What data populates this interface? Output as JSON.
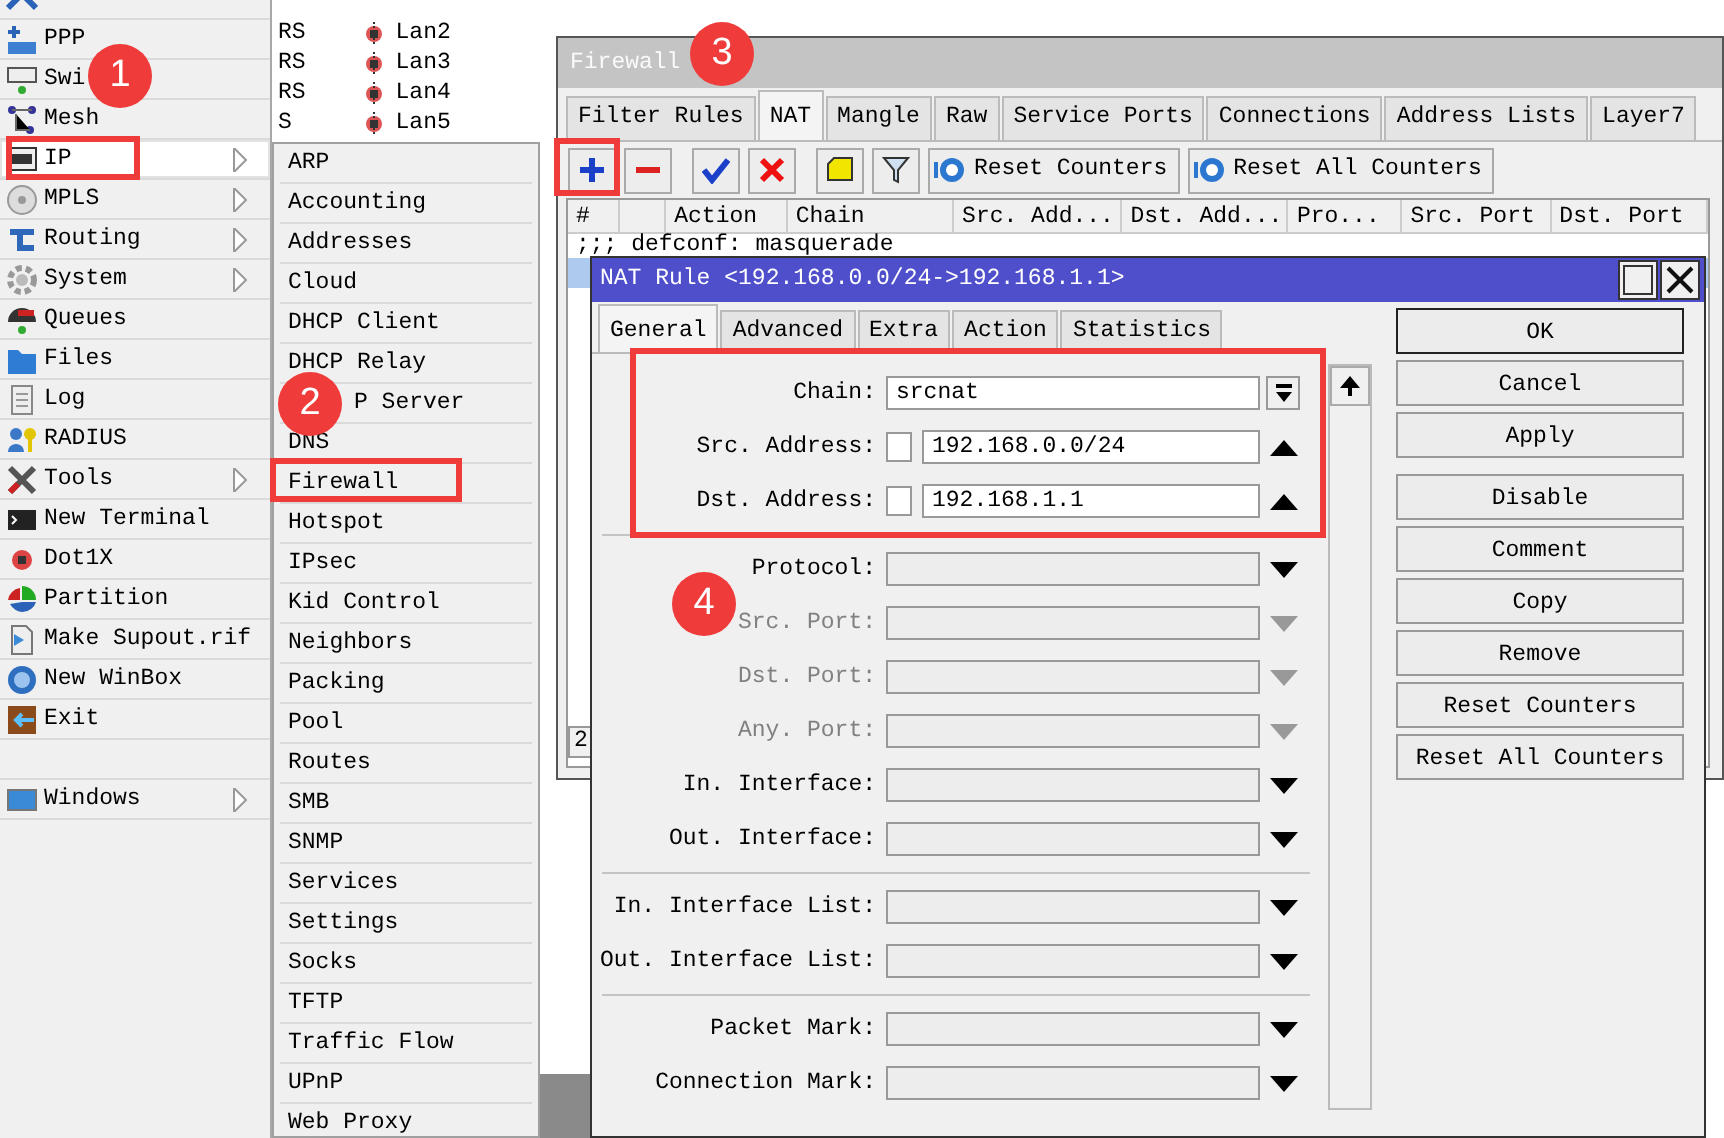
{
  "interfaces": {
    "rows": [
      {
        "flags": "RS",
        "name": "Lan2"
      },
      {
        "flags": "RS",
        "name": "Lan3"
      },
      {
        "flags": "RS",
        "name": "Lan4"
      },
      {
        "flags": "S",
        "name": "Lan5"
      }
    ]
  },
  "left_menu": {
    "items": [
      {
        "kind": "cut",
        "submenu": false,
        "selected": false
      },
      {
        "kind": "item",
        "label": "PPP",
        "submenu": false,
        "selected": false
      },
      {
        "kind": "item",
        "label": "Swi",
        "submenu": false,
        "selected": false
      },
      {
        "kind": "item",
        "label": "Mesh",
        "submenu": false,
        "selected": false
      },
      {
        "kind": "item",
        "label": "IP",
        "submenu": true,
        "selected": true
      },
      {
        "kind": "item",
        "label": "MPLS",
        "submenu": true,
        "selected": false
      },
      {
        "kind": "item",
        "label": "Routing",
        "submenu": true,
        "selected": false
      },
      {
        "kind": "item",
        "label": "System",
        "submenu": true,
        "selected": false
      },
      {
        "kind": "item",
        "label": "Queues",
        "submenu": false,
        "selected": false
      },
      {
        "kind": "item",
        "label": "Files",
        "submenu": false,
        "selected": false
      },
      {
        "kind": "item",
        "label": "Log",
        "submenu": false,
        "selected": false
      },
      {
        "kind": "item",
        "label": "RADIUS",
        "submenu": false,
        "selected": false
      },
      {
        "kind": "item",
        "label": "Tools",
        "submenu": true,
        "selected": false
      },
      {
        "kind": "item",
        "label": "New Terminal",
        "submenu": false,
        "selected": false
      },
      {
        "kind": "item",
        "label": "Dot1X",
        "submenu": false,
        "selected": false
      },
      {
        "kind": "item",
        "label": "Partition",
        "submenu": false,
        "selected": false
      },
      {
        "kind": "item",
        "label": "Make Supout.rif",
        "submenu": false,
        "selected": false
      },
      {
        "kind": "item",
        "label": "New WinBox",
        "submenu": false,
        "selected": false
      },
      {
        "kind": "item",
        "label": "Exit",
        "submenu": false,
        "selected": false
      },
      {
        "kind": "spacer"
      },
      {
        "kind": "item",
        "label": "Windows",
        "submenu": true,
        "selected": false
      }
    ]
  },
  "ip_submenu": {
    "items": [
      "ARP",
      "Accounting",
      "Addresses",
      "Cloud",
      "DHCP Client",
      "DHCP Relay",
      "P Server",
      "DNS",
      "Firewall",
      "Hotspot",
      "IPsec",
      "Kid Control",
      "Neighbors",
      "Packing",
      "Pool",
      "Routes",
      "SMB",
      "SNMP",
      "Services",
      "Settings",
      "Socks",
      "TFTP",
      "Traffic Flow",
      "UPnP",
      "Web Proxy"
    ]
  },
  "firewall": {
    "title": "Firewall",
    "tabs": [
      {
        "label": "Filter Rules",
        "selected": false
      },
      {
        "label": "NAT",
        "selected": true
      },
      {
        "label": "Mangle",
        "selected": false
      },
      {
        "label": "Raw",
        "selected": false
      },
      {
        "label": "Service Ports",
        "selected": false
      },
      {
        "label": "Connections",
        "selected": false
      },
      {
        "label": "Address Lists",
        "selected": false
      },
      {
        "label": "Layer7",
        "selected": false
      }
    ],
    "toolbar_buttons": [
      "Reset Counters",
      "Reset All Counters"
    ],
    "columns": [
      "#",
      "Action",
      "Chain",
      "Src. Add...",
      "Dst. Add...",
      "Pro...",
      "Src. Port",
      "Dst. Port"
    ],
    "rows": [
      {
        "kind": "comment",
        "text": ";;; defconf: masquerade",
        "selected": false
      },
      {
        "kind": "rule",
        "selected": true
      }
    ],
    "status": "2"
  },
  "nat_rule": {
    "title": "NAT Rule <192.168.0.0/24->192.168.1.1>",
    "tabs": [
      {
        "label": "General",
        "selected": true
      },
      {
        "label": "Advanced",
        "selected": false
      },
      {
        "label": "Extra",
        "selected": false
      },
      {
        "label": "Action",
        "selected": false
      },
      {
        "label": "Statistics",
        "selected": false
      }
    ],
    "groups": [
      {
        "fields": [
          {
            "kind": "chain",
            "label": "Chain:",
            "value": "srcnat",
            "disabled": false
          },
          {
            "kind": "address",
            "label": "Src. Address:",
            "value": "192.168.0.0/24",
            "negated": false,
            "disabled": false
          },
          {
            "kind": "address",
            "label": "Dst. Address:",
            "value": "192.168.1.1",
            "negated": false,
            "disabled": false
          }
        ]
      },
      {
        "fields": [
          {
            "kind": "select",
            "label": "Protocol:",
            "disabled": false
          },
          {
            "kind": "select",
            "label": "Src. Port:",
            "disabled": true
          },
          {
            "kind": "select",
            "label": "Dst. Port:",
            "disabled": true
          },
          {
            "kind": "select",
            "label": "Any. Port:",
            "disabled": true
          },
          {
            "kind": "select",
            "label": "In. Interface:",
            "disabled": false
          },
          {
            "kind": "select",
            "label": "Out. Interface:",
            "disabled": false
          }
        ]
      },
      {
        "fields": [
          {
            "kind": "select",
            "label": "In. Interface List:",
            "disabled": false
          },
          {
            "kind": "select",
            "label": "Out. Interface List:",
            "disabled": false
          }
        ]
      },
      {
        "fields": [
          {
            "kind": "select",
            "label": "Packet Mark:",
            "disabled": false
          },
          {
            "kind": "select",
            "label": "Connection Mark:",
            "disabled": false
          }
        ]
      }
    ],
    "buttons": [
      {
        "label": "OK",
        "default": true
      },
      {
        "label": "Cancel",
        "default": false
      },
      {
        "label": "Apply",
        "default": false
      },
      {
        "label": "Disable",
        "default": false
      },
      {
        "label": "Comment",
        "default": false
      },
      {
        "label": "Copy",
        "default": false
      },
      {
        "label": "Remove",
        "default": false
      },
      {
        "label": "Reset Counters",
        "default": false
      },
      {
        "label": "Reset All Counters",
        "default": false
      }
    ]
  },
  "annotations": [
    {
      "kind": "badge",
      "text": "1"
    },
    {
      "kind": "frame"
    },
    {
      "kind": "badge",
      "text": "2"
    },
    {
      "kind": "frame"
    },
    {
      "kind": "badge",
      "text": "3"
    },
    {
      "kind": "frame"
    },
    {
      "kind": "badge",
      "text": "4"
    },
    {
      "kind": "frame"
    }
  ]
}
